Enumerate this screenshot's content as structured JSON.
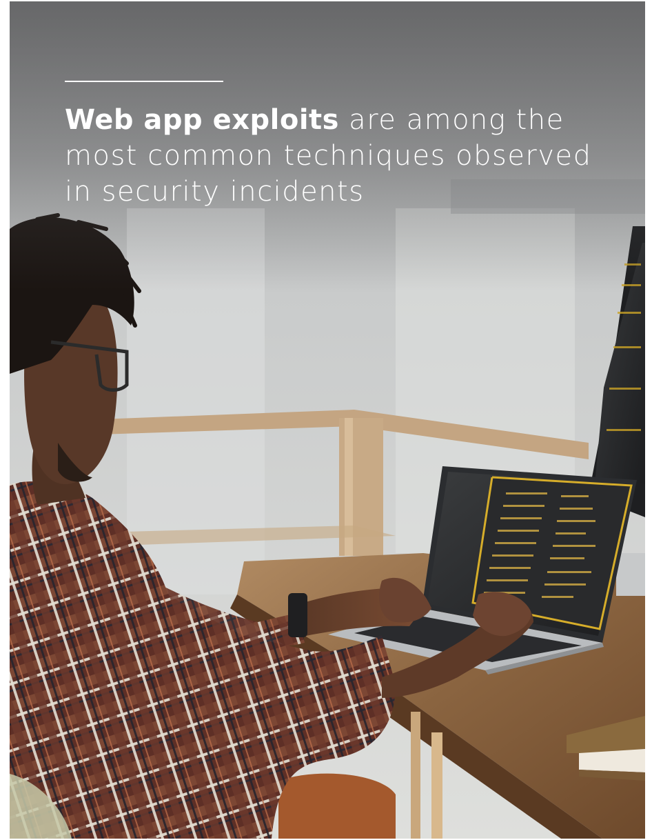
{
  "headline": {
    "bold": "Web app exploits",
    "rest": " are among the most common techniques observed in security incidents"
  },
  "colors": {
    "headline_text": "#ffffff",
    "rule": "#ffffff"
  }
}
